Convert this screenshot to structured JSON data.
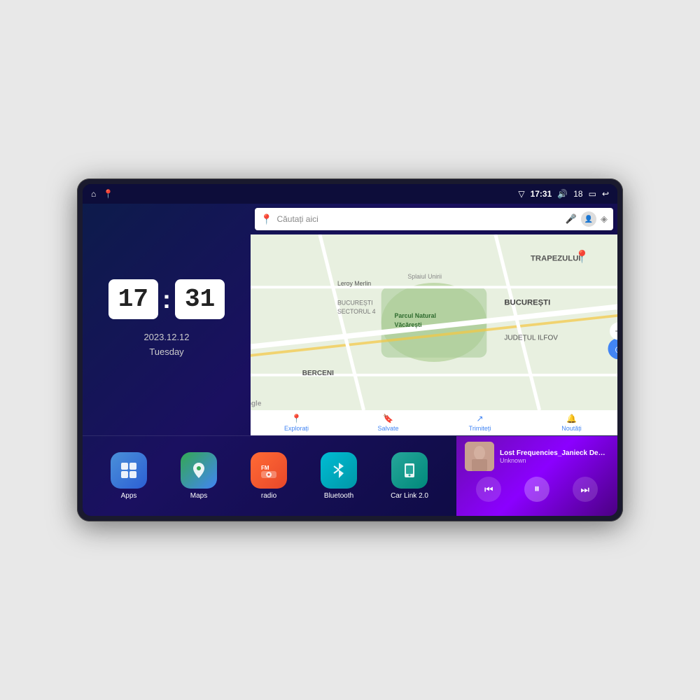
{
  "device": {
    "screen": {
      "status_bar": {
        "left_icons": [
          "home",
          "maps-pin"
        ],
        "time": "17:31",
        "right_icons": [
          "signal",
          "volume",
          "battery-18",
          "battery",
          "back"
        ],
        "battery_level": "18"
      },
      "clock_widget": {
        "hour": "17",
        "minute": "31",
        "date": "2023.12.12",
        "day": "Tuesday"
      },
      "map": {
        "search_placeholder": "Căutați aici",
        "nav_items": [
          {
            "label": "Explorați",
            "icon": "pin"
          },
          {
            "label": "Salvate",
            "icon": "bookmark"
          },
          {
            "label": "Trimiteți",
            "icon": "share"
          },
          {
            "label": "Noutăți",
            "icon": "bell"
          }
        ],
        "labels": [
          "TRAPEZULUI",
          "BUCUREȘTI",
          "JUDEȚUL ILFOV",
          "BERCENI",
          "Parcul Natural Văcărești",
          "Leroy Merlin",
          "BUCUREȘTI SECTORUL 4",
          "Splaiul Unirii"
        ],
        "google_logo": "Google"
      },
      "app_icons": [
        {
          "id": "apps",
          "label": "Apps",
          "icon": "⊞",
          "class": "icon-apps"
        },
        {
          "id": "maps",
          "label": "Maps",
          "icon": "📍",
          "class": "icon-maps"
        },
        {
          "id": "radio",
          "label": "radio",
          "icon": "📻",
          "class": "icon-radio"
        },
        {
          "id": "bluetooth",
          "label": "Bluetooth",
          "icon": "⚡",
          "class": "icon-bluetooth"
        },
        {
          "id": "carlink",
          "label": "Car Link 2.0",
          "icon": "📱",
          "class": "icon-carlink"
        }
      ],
      "music_player": {
        "title": "Lost Frequencies_Janieck Devy-...",
        "artist": "Unknown",
        "controls": [
          "prev",
          "play",
          "next"
        ]
      }
    }
  }
}
